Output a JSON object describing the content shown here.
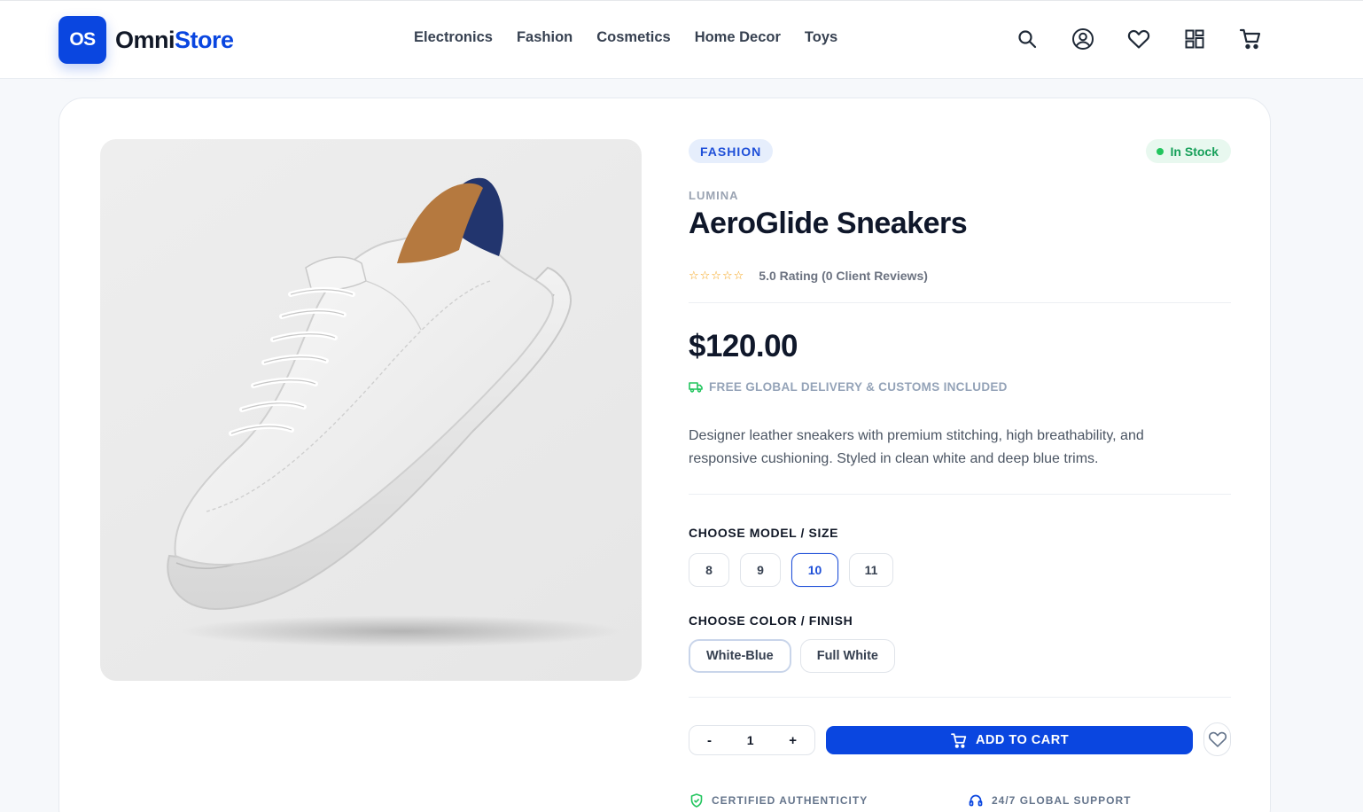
{
  "brand": {
    "badge": "OS",
    "name_a": "Omni",
    "name_b": "Store"
  },
  "nav": [
    "Electronics",
    "Fashion",
    "Cosmetics",
    "Home Decor",
    "Toys"
  ],
  "header_icons": [
    "search-icon",
    "account-icon",
    "wishlist-icon",
    "dashboard-icon",
    "cart-icon"
  ],
  "product": {
    "category": "FASHION",
    "stock": "In Stock",
    "brand": "LUMINA",
    "title": "AeroGlide Sneakers",
    "stars": "☆☆☆☆☆",
    "rating_text": "5.0 Rating (0 Client Reviews)",
    "price": "$120.00",
    "delivery": "FREE GLOBAL DELIVERY & CUSTOMS INCLUDED",
    "description": "Designer leather sneakers with premium stitching, high breathability, and responsive cushioning. Styled in clean white and deep blue trims.",
    "size_label": "CHOOSE MODEL / SIZE",
    "sizes": [
      "8",
      "9",
      "10",
      "11"
    ],
    "selected_size": "10",
    "color_label": "CHOOSE COLOR / FINISH",
    "colors": [
      "White-Blue",
      "Full White"
    ],
    "selected_color": "White-Blue",
    "qty_minus": "-",
    "quantity": "1",
    "qty_plus": "+",
    "add_to_cart": "ADD TO CART",
    "trust": [
      "CERTIFIED AUTHENTICITY",
      "24/7 GLOBAL SUPPORT"
    ]
  },
  "colors_theme": {
    "accent": "#0a46e0",
    "stock_green": "#17a05a",
    "star": "#f59e0b"
  }
}
